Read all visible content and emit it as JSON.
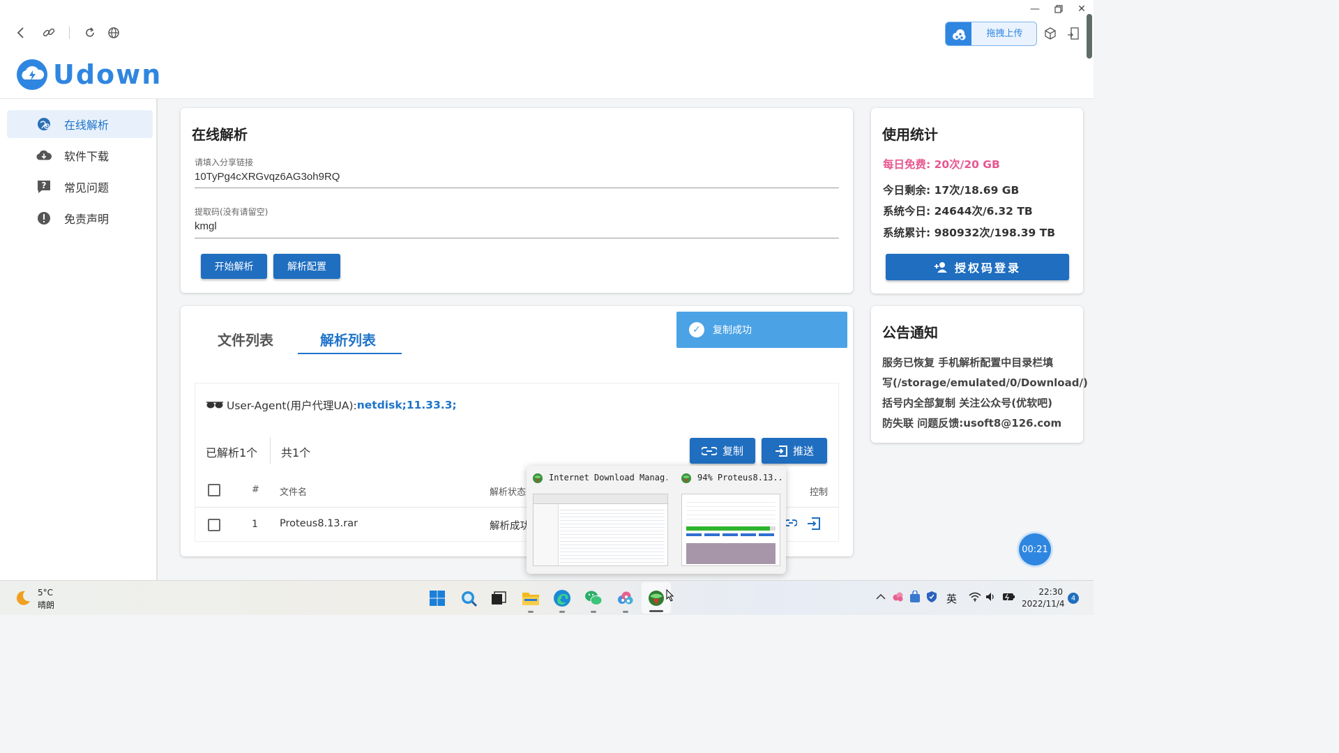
{
  "app": {
    "logo_text": "Udown",
    "upload_button": "拖拽上传"
  },
  "colors": {
    "accent": "#2f86e0",
    "button": "#1f6ec0",
    "pink": "#e8578f",
    "ua_value": "#1f74c9",
    "toast": "#4ba3e6"
  },
  "sidebar": {
    "items": [
      {
        "label": "在线解析",
        "icon": "globe-refresh-icon",
        "active": true
      },
      {
        "label": "软件下载",
        "icon": "cloud-download-icon"
      },
      {
        "label": "常见问题",
        "icon": "question-icon"
      },
      {
        "label": "免责声明",
        "icon": "alert-icon"
      }
    ]
  },
  "parse": {
    "title": "在线解析",
    "link_label": "请填入分享链接",
    "link_value": "10TyPg4cXRGvqz6AG3oh9RQ",
    "code_label": "提取码(没有请留空)",
    "code_value": "kmgl",
    "start_button": "开始解析",
    "config_button": "解析配置"
  },
  "stats": {
    "title": "使用统计",
    "daily_free": "每日免费: 20次/20 GB",
    "today_remaining": "今日剩余: 17次/18.69 GB",
    "system_today": "系统今日: 24644次/6.32 TB",
    "system_total": "系统累计: 980932次/198.39 TB",
    "auth_button": "授权码登录"
  },
  "notice": {
    "title": "公告通知",
    "lines": [
      "服务已恢复 手机解析配置中目录栏填",
      "写(/storage/emulated/0/Download/)",
      "括号内全部复制 关注公众号(优软吧)",
      "防失联 问题反馈:usoft8@126.com"
    ]
  },
  "list": {
    "tabs": [
      {
        "label": "文件列表"
      },
      {
        "label": "解析列表",
        "active": true
      }
    ],
    "ua_label": "User-Agent(用户代理UA): ",
    "ua_value": "netdisk;11.33.3;",
    "parsed_count": "已解析1个",
    "total_count": "共1个",
    "copy_button": "复制",
    "push_button": "推送",
    "columns": {
      "index": "#",
      "filename": "文件名",
      "status": "解析状态",
      "control": "控制"
    },
    "rows": [
      {
        "index": "1",
        "filename": "Proteus8.13.rar",
        "status": "解析成功"
      }
    ]
  },
  "toast": {
    "text": "复制成功"
  },
  "preview": {
    "window1_title": "Internet Download Manag...",
    "window2_title": "94% Proteus8.13...",
    "progress": 0.94
  },
  "timer": "00:21",
  "taskbar": {
    "weather_temp": "5°C",
    "weather_desc": "晴朗",
    "ime": "英",
    "time": "22:30",
    "date": "2022/11/4",
    "notification_count": "4"
  }
}
